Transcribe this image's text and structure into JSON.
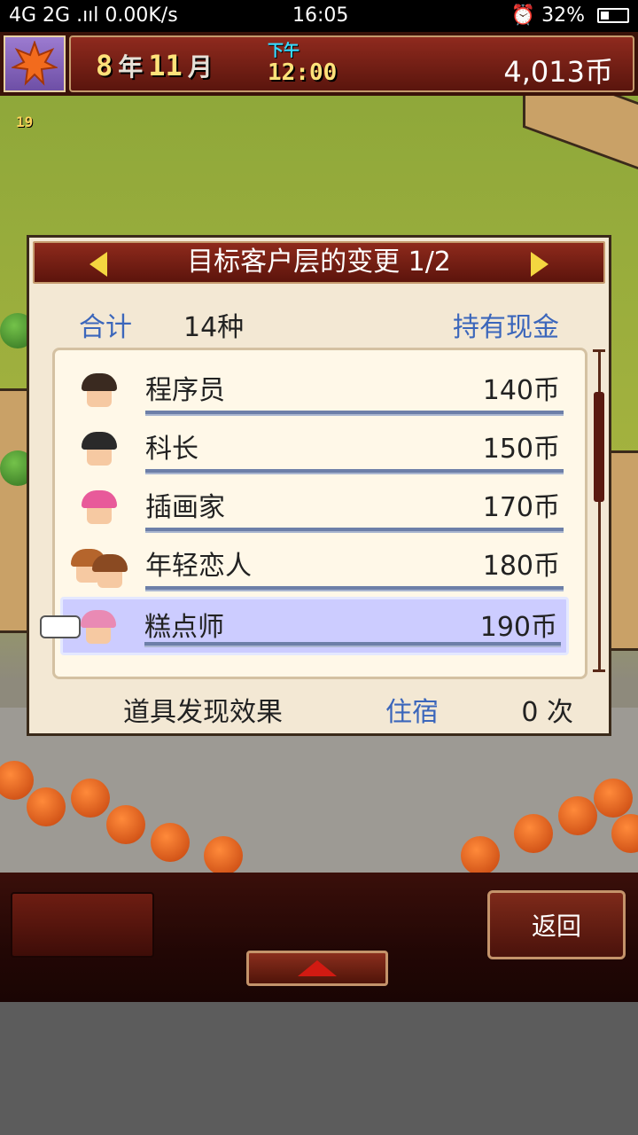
{
  "status_bar": {
    "network": "4G 2G .ııl 0.00K/s",
    "time": "16:05",
    "battery": "⏰ 32%",
    "battery_level": 0.32
  },
  "top_bar": {
    "year_num": "8",
    "year_unit": "年",
    "month_num": "11",
    "month_unit": "月",
    "ampm": "下午",
    "clock": "12:00",
    "money": "4,013币"
  },
  "scene": {
    "level_badge": "19"
  },
  "dialog": {
    "title": "目标客户层的变更 1/2",
    "total_label": "合计",
    "total_value": "14种",
    "cash_label": "持有现金",
    "rows": [
      {
        "name": "程序员",
        "price": "140币",
        "hair": "#3a2a20"
      },
      {
        "name": "科长",
        "price": "150币",
        "hair": "#2a2a2a"
      },
      {
        "name": "插画家",
        "price": "170币",
        "hair": "#e85a9a"
      },
      {
        "name": "年轻恋人",
        "price": "180币",
        "hair": "#b5652c"
      },
      {
        "name": "糕点师",
        "price": "190币",
        "hair": "#e98ab4"
      }
    ],
    "footer_label": "道具发现效果",
    "footer_link": "住宿",
    "footer_count": "0 次"
  },
  "bottom_bar": {
    "back_label": "返回"
  }
}
